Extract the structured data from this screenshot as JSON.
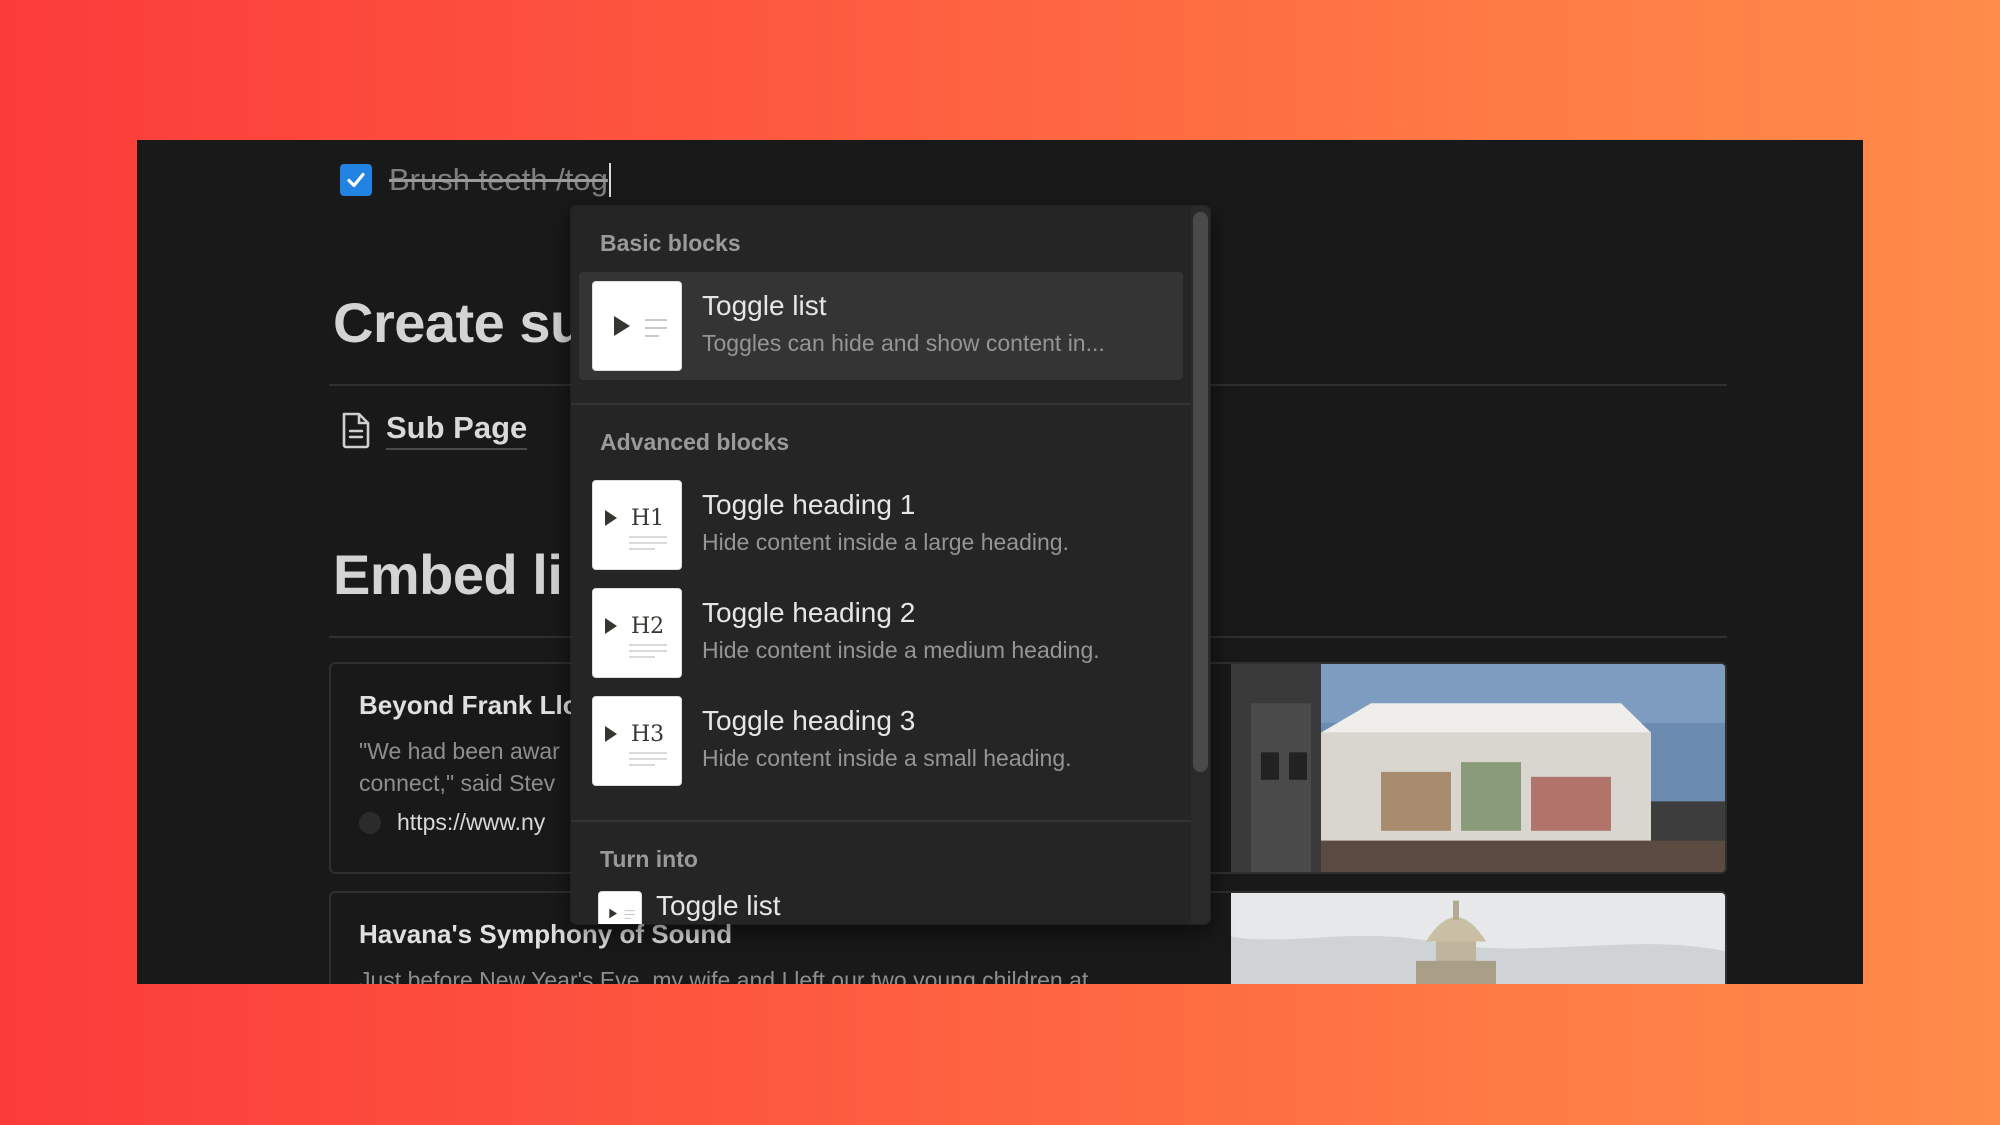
{
  "todo": {
    "text": "Brush teeth /tog",
    "checked": true
  },
  "headings": {
    "create": "Create su",
    "embed": "Embed li"
  },
  "subpage": {
    "label": "Sub Page",
    "icon": "page-icon"
  },
  "bookmarks": [
    {
      "title": "Beyond Frank Llo",
      "desc_line1": "\"We had been awar",
      "desc_line2": "connect,\" said Stev",
      "url": "https://www.ny"
    },
    {
      "title": "Havana's Symphony of Sound",
      "desc_line1": "Just before New Year's Eve, my wife and I left our two young children at"
    }
  ],
  "menu": {
    "basic_label": "Basic blocks",
    "advanced_label": "Advanced blocks",
    "turn_into_label": "Turn into",
    "basic_items": [
      {
        "title": "Toggle list",
        "desc": "Toggles can hide and show content in...",
        "icon": "toggle-list-icon"
      }
    ],
    "advanced_items": [
      {
        "title": "Toggle heading 1",
        "desc": "Hide content inside a large heading.",
        "icon": "toggle-h1-icon",
        "badge": "H1"
      },
      {
        "title": "Toggle heading 2",
        "desc": "Hide content inside a medium heading.",
        "icon": "toggle-h2-icon",
        "badge": "H2"
      },
      {
        "title": "Toggle heading 3",
        "desc": "Hide content inside a small heading.",
        "icon": "toggle-h3-icon",
        "badge": "H3"
      }
    ],
    "turn_into_items": [
      {
        "title": "Toggle list",
        "icon": "toggle-list-icon"
      }
    ]
  },
  "colors": {
    "checkbox": "#2383e2",
    "background": "#191919",
    "menu": "#252525"
  }
}
